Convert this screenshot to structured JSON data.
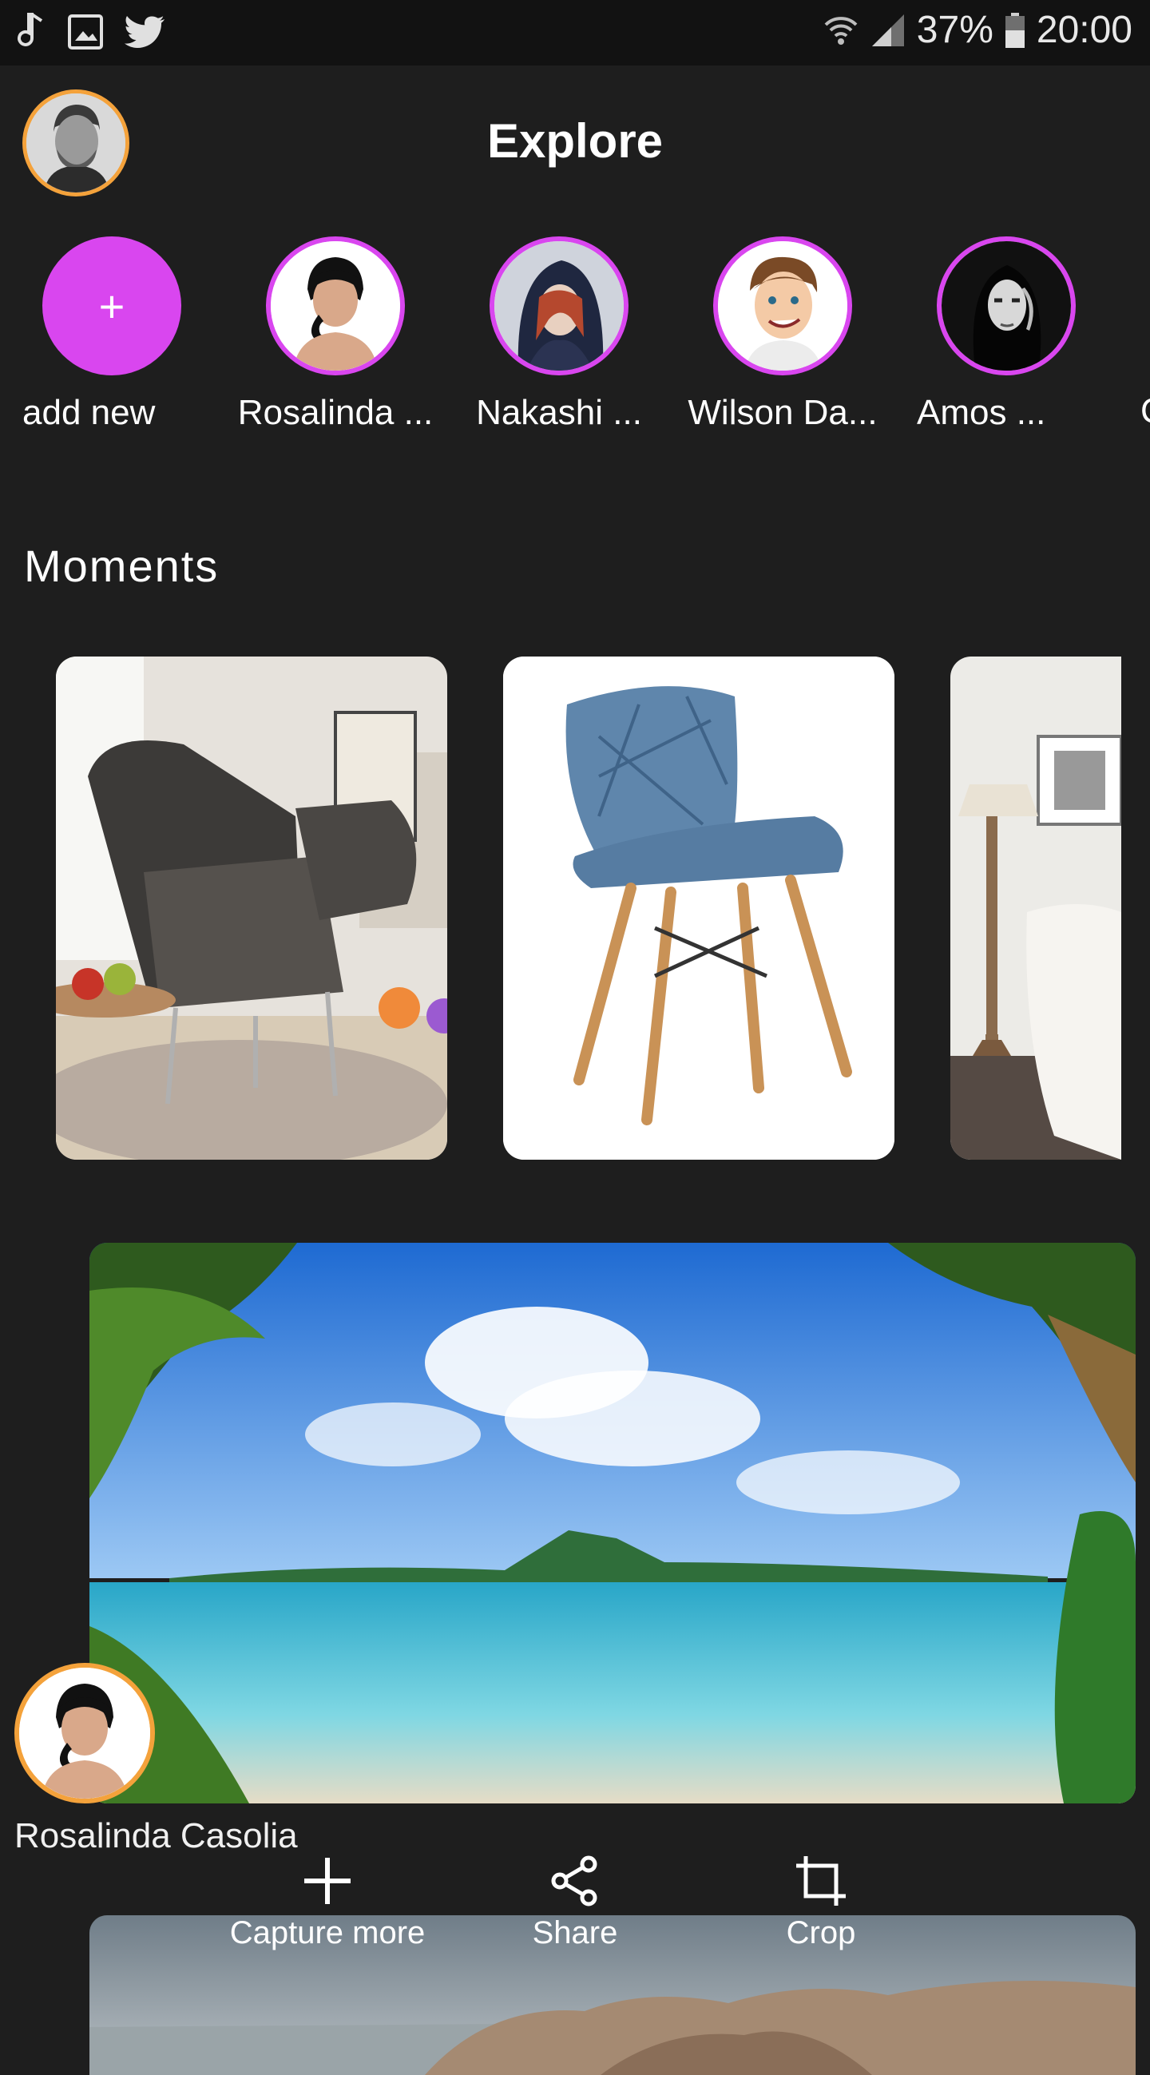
{
  "status_bar": {
    "battery": "37%",
    "time": "20:00"
  },
  "header": {
    "title": "Explore"
  },
  "stories": [
    {
      "label": "add new",
      "icon": "+"
    },
    {
      "label": "Rosalinda ..."
    },
    {
      "label": "Nakashi ..."
    },
    {
      "label": "Wilson Da..."
    },
    {
      "label": "Amos ..."
    }
  ],
  "moments": {
    "heading": "Moments"
  },
  "post": {
    "author": "Rosalinda Casolia",
    "actions": {
      "capture": "Capture more",
      "share": "Share",
      "crop": "Crop"
    }
  },
  "colors": {
    "accent": "#d946ef",
    "own_ring": "#f4a23b",
    "background": "#1e1e1e"
  }
}
